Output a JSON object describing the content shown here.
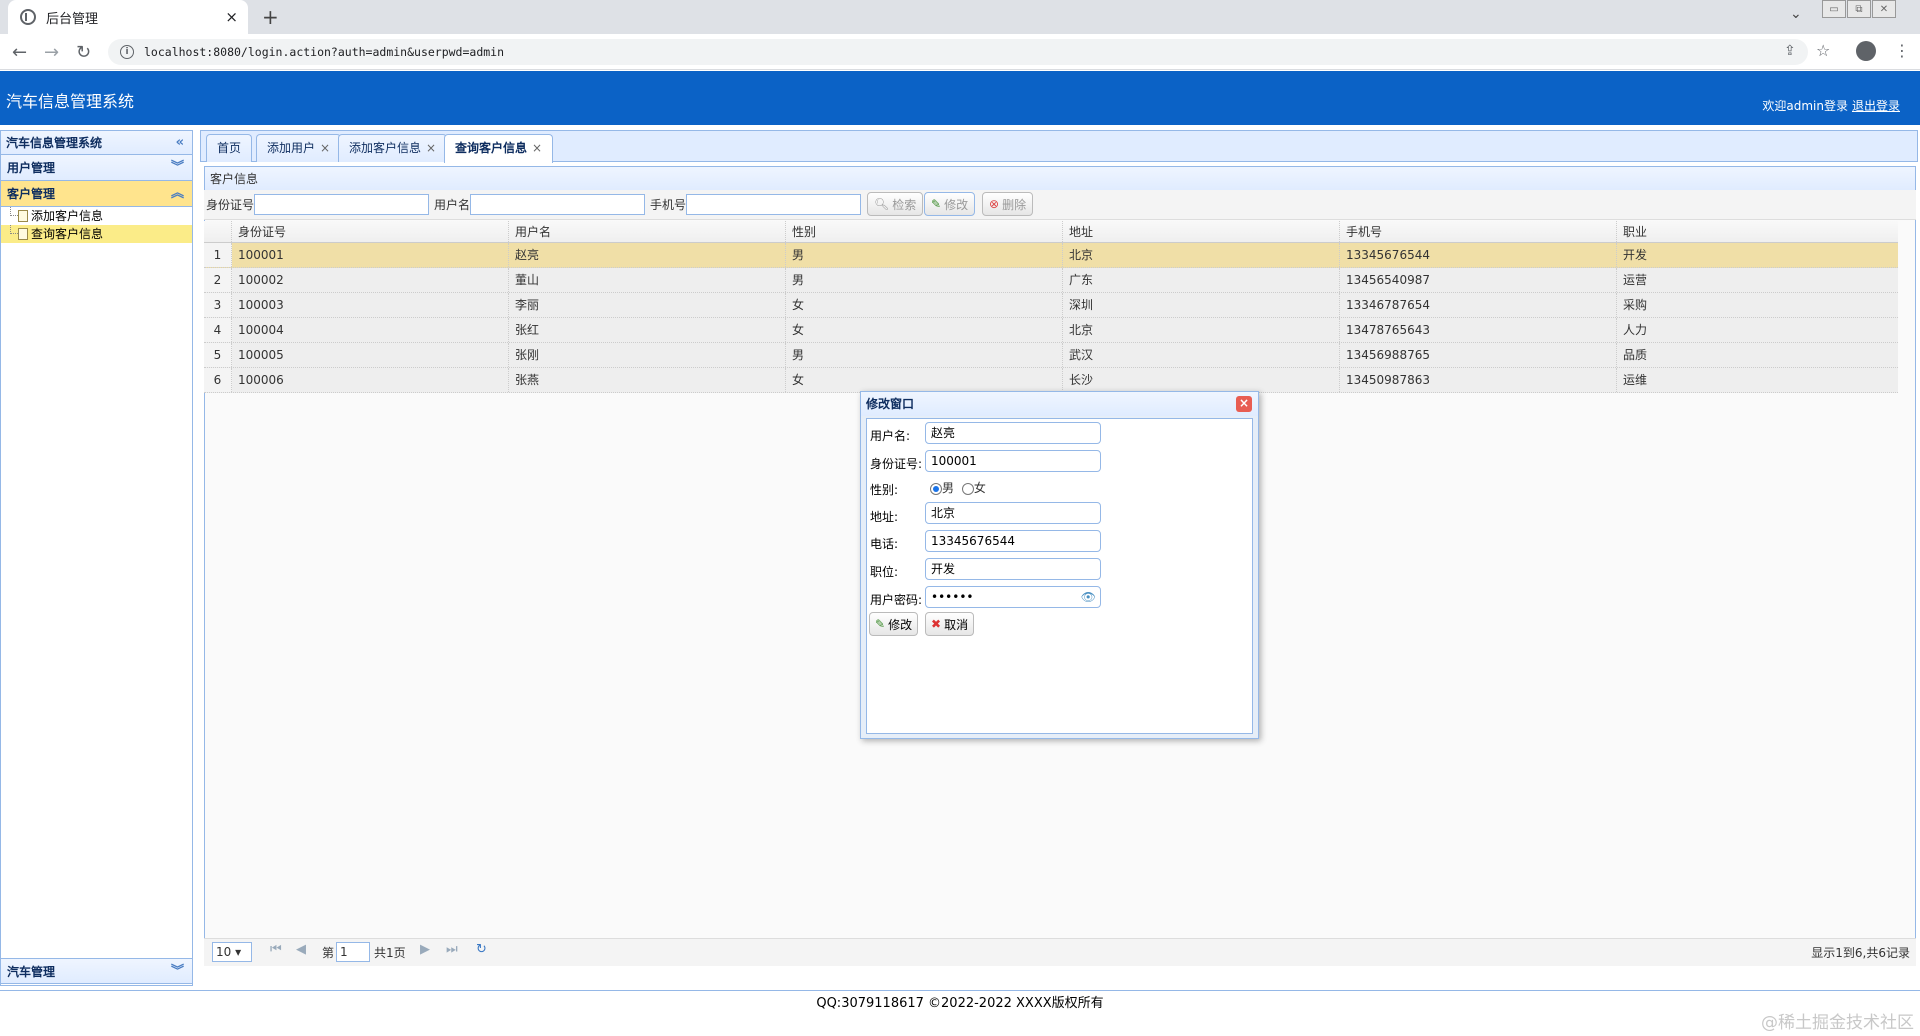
{
  "browser": {
    "tab_title": "后台管理",
    "tab_close": "×",
    "new_tab": "+",
    "url": "localhost:8080/login.action?auth=admin&userpwd=admin"
  },
  "header": {
    "title": "汽车信息管理系统",
    "welcome": "欢迎admin登录",
    "logout": "退出登录",
    "color": "#0b62c6"
  },
  "sidebar": {
    "title": "汽车信息管理系统",
    "sections": [
      {
        "label": "用户管理"
      },
      {
        "label": "客户管理",
        "items": [
          {
            "label": "添加客户信息"
          },
          {
            "label": "查询客户信息"
          }
        ]
      },
      {
        "label": "汽车管理"
      }
    ]
  },
  "tabs": [
    {
      "label": "首页"
    },
    {
      "label": "添加用户"
    },
    {
      "label": "添加客户信息"
    },
    {
      "label": "查询客户信息"
    }
  ],
  "content": {
    "panel_title": "客户信息",
    "search": {
      "id_label": "身份证号",
      "user_label": "用户名",
      "phone_label": "手机号",
      "search_btn": "检索",
      "edit_btn": "修改",
      "delete_btn": "删除"
    },
    "table": {
      "columns": [
        "身份证号",
        "用户名",
        "性别",
        "地址",
        "手机号",
        "职业"
      ],
      "rows": [
        {
          "n": "1",
          "id": "100001",
          "name": "赵亮",
          "sex": "男",
          "addr": "北京",
          "phone": "13345676544",
          "job": "开发"
        },
        {
          "n": "2",
          "id": "100002",
          "name": "董山",
          "sex": "男",
          "addr": "广东",
          "phone": "13456540987",
          "job": "运营"
        },
        {
          "n": "3",
          "id": "100003",
          "name": "李丽",
          "sex": "女",
          "addr": "深圳",
          "phone": "13346787654",
          "job": "采购"
        },
        {
          "n": "4",
          "id": "100004",
          "name": "张红",
          "sex": "女",
          "addr": "北京",
          "phone": "13478765643",
          "job": "人力"
        },
        {
          "n": "5",
          "id": "100005",
          "name": "张刚",
          "sex": "男",
          "addr": "武汉",
          "phone": "13456988765",
          "job": "品质"
        },
        {
          "n": "6",
          "id": "100006",
          "name": "张燕",
          "sex": "女",
          "addr": "长沙",
          "phone": "13450987863",
          "job": "运维"
        }
      ]
    },
    "pager": {
      "page_size": "10",
      "page_prefix": "第",
      "page_value": "1",
      "page_total": "共1页",
      "summary": "显示1到6,共6记录"
    }
  },
  "dialog": {
    "title": "修改窗口",
    "fields": {
      "name_label": "用户名:",
      "name_value": "赵亮",
      "id_label": "身份证号:",
      "id_value": "100001",
      "sex_label": "性别:",
      "sex_male": "男",
      "sex_female": "女",
      "addr_label": "地址:",
      "addr_value": "北京",
      "phone_label": "电话:",
      "phone_value": "13345676544",
      "job_label": "职位:",
      "job_value": "开发",
      "pwd_label": "用户密码:",
      "pwd_value": "••••••"
    },
    "ok_btn": "修改",
    "cancel_btn": "取消"
  },
  "footer": {
    "text": "QQ:3079118617 ©2022-2022 XXXX版权所有",
    "watermark": "@稀土掘金技术社区"
  }
}
